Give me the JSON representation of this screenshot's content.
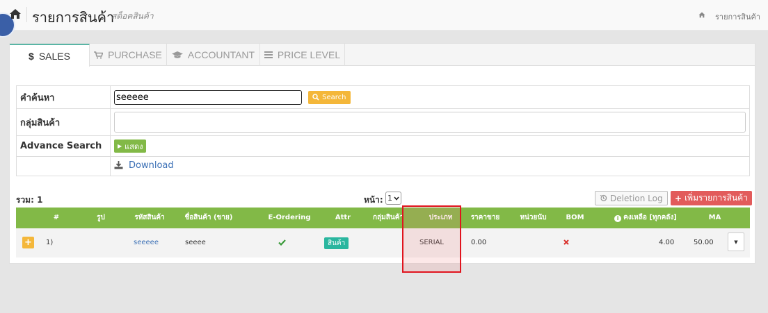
{
  "header": {
    "title": "รายการสินค้า",
    "subtitle": "สต็อคสินค้า",
    "breadcrumb": "รายการสินค้า"
  },
  "tabs": [
    {
      "label": "SALES",
      "icon": "dollar-icon",
      "active": true
    },
    {
      "label": "PURCHASE",
      "icon": "cart-icon",
      "active": false
    },
    {
      "label": "ACCOUNTANT",
      "icon": "graduation-cap-icon",
      "active": false
    },
    {
      "label": "PRICE LEVEL",
      "icon": "list-icon",
      "active": false
    }
  ],
  "search_form": {
    "keyword_label": "คำค้นหา",
    "keyword_value": "seeeee",
    "search_button": "Search",
    "group_label": "กลุ่มสินค้า",
    "group_value": "",
    "advance_label": "Advance Search",
    "show_button": "แสดง",
    "download_label": "Download"
  },
  "list_bar": {
    "total_text": "รวม: 1",
    "page_label": "หน้า:",
    "page_value": "1",
    "deletion_log": "Deletion Log",
    "add_button": "เพิ่มรายการสินค้า"
  },
  "table": {
    "columns": [
      "#",
      "รูป",
      "รหัสสินค้า",
      "ชื่อสินค้า (ขาย)",
      "E-Ordering",
      "Attr",
      "กลุ่มสินค้า",
      "ประเภท",
      "ราคาขาย",
      "หน่วยนับ",
      "BOM",
      "คงเหลือ [ทุกคลัง]",
      "MA"
    ],
    "rows": [
      {
        "index": "1)",
        "code": "seeeee",
        "name": "seeee",
        "e_ordering": true,
        "attr": "สินค้า",
        "group": "",
        "type": "SERIAL",
        "price": "0.00",
        "unit": "",
        "bom": false,
        "stock": "4.00",
        "ma": "50.00"
      }
    ]
  },
  "colors": {
    "green": "#82b947",
    "orange": "#f4b73a",
    "red": "#e25b5b",
    "teal": "#2ab69f",
    "link": "#3a6fb5",
    "highlight_box": "#e0141e"
  }
}
